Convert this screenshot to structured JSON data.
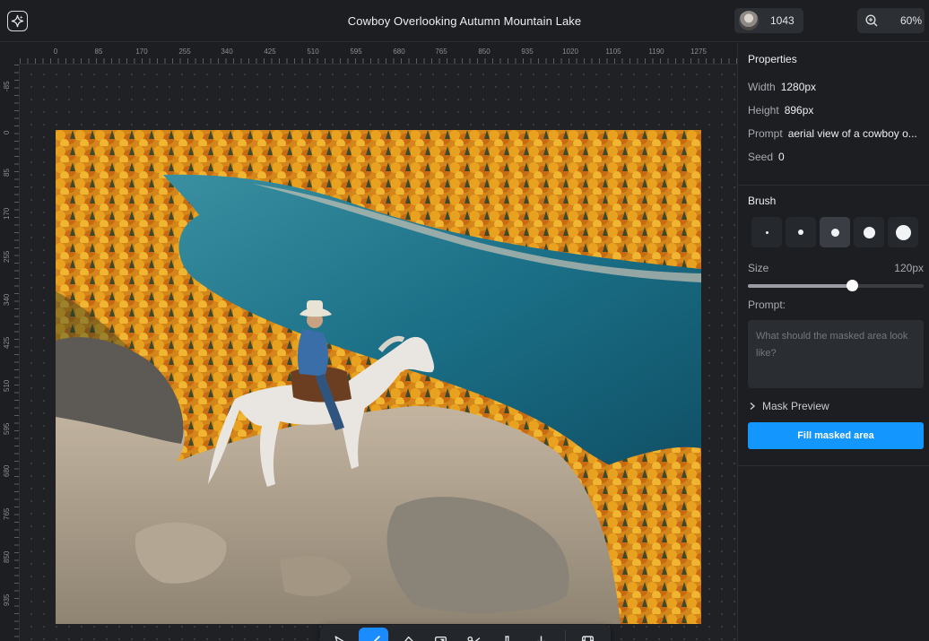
{
  "header": {
    "title": "Cowboy Overlooking Autumn Mountain Lake",
    "user_credits": "1043",
    "zoom": "60%"
  },
  "rulers": {
    "top": [
      "0",
      "85",
      "170",
      "255",
      "340",
      "425",
      "510",
      "595",
      "680",
      "765",
      "850",
      "935",
      "1020",
      "1105",
      "1190",
      "1275"
    ],
    "left": [
      "-85",
      "0",
      "85",
      "170",
      "255",
      "340",
      "425",
      "510",
      "595",
      "680",
      "765",
      "850",
      "935"
    ]
  },
  "toolbar": {
    "tools": [
      "select-icon",
      "brush-icon",
      "eraser-icon",
      "crop-icon",
      "scissors-icon",
      "flask-icon",
      "download-icon",
      "film-icon"
    ],
    "active_tool": "brush-icon",
    "accent": "#1a8cff"
  },
  "panel": {
    "properties_title": "Properties",
    "width_label": "Width",
    "width_value": "1280px",
    "height_label": "Height",
    "height_value": "896px",
    "prompt_label": "Prompt",
    "prompt_value": "aerial view of a cowboy o...",
    "seed_label": "Seed",
    "seed_value": "0",
    "brush_title": "Brush",
    "brush_sizes_selected_index": 2,
    "size_label": "Size",
    "size_value": "120px",
    "size_slider_fraction": 0.6,
    "prompt_field_label": "Prompt:",
    "prompt_placeholder": "What should the masked area look like?",
    "mask_preview_label": "Mask Preview",
    "fill_button_label": "Fill masked area",
    "fill_button_color": "#1496ff"
  }
}
